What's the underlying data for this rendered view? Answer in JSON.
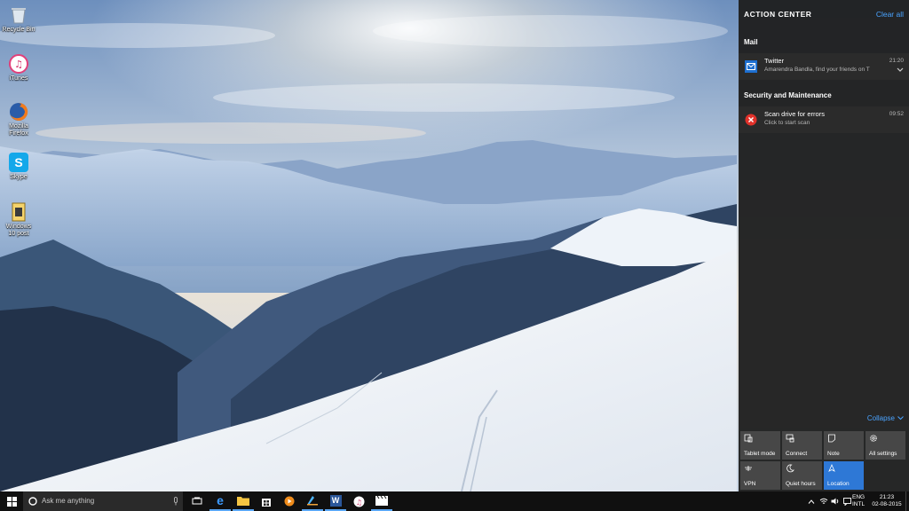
{
  "desktop": {
    "icons": [
      {
        "label": "Recycle Bin",
        "icon": "recycle-bin-icon"
      },
      {
        "label": "iTunes",
        "icon": "itunes-icon"
      },
      {
        "label": "Mozilla Firefox",
        "icon": "firefox-icon"
      },
      {
        "label": "Skype",
        "icon": "skype-icon"
      },
      {
        "label": "Windows 10 post",
        "icon": "document-icon"
      }
    ]
  },
  "action_center": {
    "title": "ACTION CENTER",
    "clear_all": "Clear all",
    "groups": [
      {
        "name": "Mail",
        "notifications": [
          {
            "title": "Twitter",
            "body": "Amarendra Bandla, find your friends on T",
            "time": "21:20",
            "icon": "mail-icon"
          }
        ]
      },
      {
        "name": "Security and Maintenance",
        "notifications": [
          {
            "title": "Scan drive for errors",
            "body": "Click to start scan",
            "time": "09:52",
            "icon": "error-icon"
          }
        ]
      }
    ],
    "collapse": "Collapse",
    "quick_actions": [
      {
        "label": "Tablet mode",
        "icon": "tablet-mode-icon",
        "on": false
      },
      {
        "label": "Connect",
        "icon": "connect-icon",
        "on": false
      },
      {
        "label": "Note",
        "icon": "note-icon",
        "on": false
      },
      {
        "label": "All settings",
        "icon": "gear-icon",
        "on": false
      },
      {
        "label": "VPN",
        "icon": "vpn-icon",
        "on": false
      },
      {
        "label": "Quiet hours",
        "icon": "moon-icon",
        "on": false
      },
      {
        "label": "Location",
        "icon": "location-icon",
        "on": true
      }
    ],
    "accent_color": "#2e78d6"
  },
  "taskbar": {
    "search_placeholder": "Ask me anything",
    "apps": [
      "task-view-icon",
      "edge-icon",
      "file-explorer-icon",
      "store-icon",
      "media-player-icon",
      "paint-icon",
      "word-icon",
      "itunes-icon",
      "movie-maker-icon"
    ],
    "language": {
      "line1": "ENG",
      "line2": "INTL"
    },
    "clock": {
      "time": "21:23",
      "date": "02-08-2015"
    }
  }
}
